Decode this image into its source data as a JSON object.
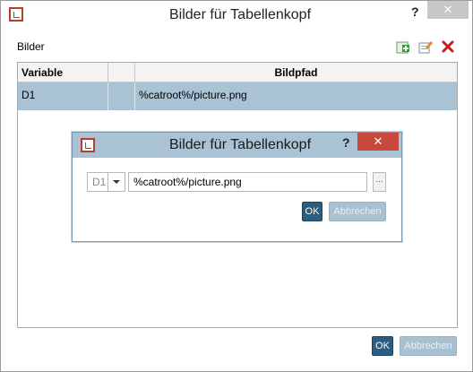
{
  "window": {
    "title": "Bilder für Tabellenkopf",
    "help": "?",
    "close": "✕"
  },
  "main": {
    "label": "Bilder",
    "toolbar": {
      "add": "add-icon",
      "edit": "edit-icon",
      "delete": "delete-icon"
    },
    "table": {
      "headers": [
        "Variable",
        "",
        "Bildpfad"
      ],
      "rows": [
        {
          "variable": "D1",
          "extra": "",
          "path": "%catroot%/picture.png"
        }
      ]
    },
    "ok_label": "OK",
    "cancel_label": "Abbrechen"
  },
  "dialog": {
    "title": "Bilder für Tabellenkopf",
    "help": "?",
    "close": "✕",
    "variable_value": "D1",
    "path_value": "%catroot%/picture.png",
    "browse_label": "...",
    "ok_label": "OK",
    "cancel_label": "Abbrechen"
  }
}
